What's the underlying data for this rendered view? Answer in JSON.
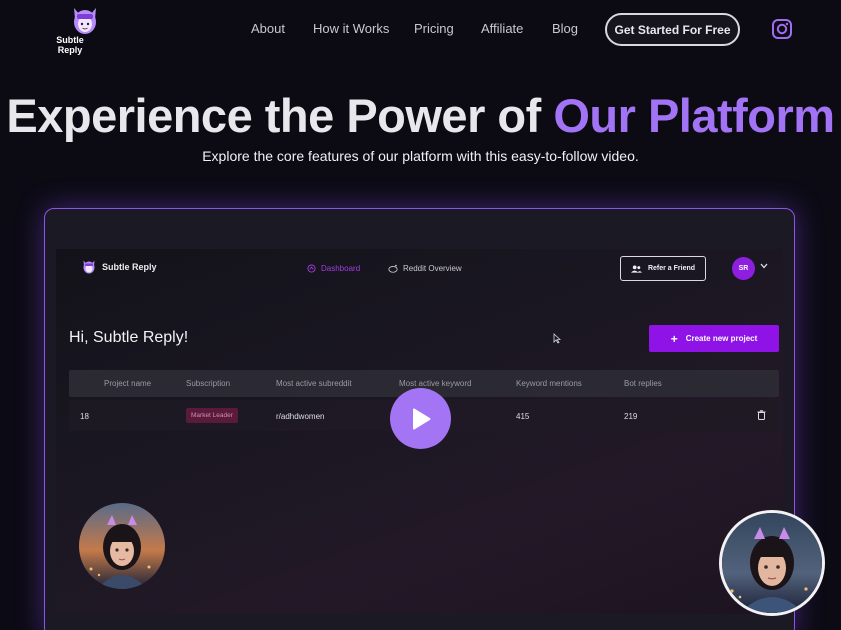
{
  "brand": {
    "line1": "Subtle",
    "line2": "Reply"
  },
  "nav": {
    "links": [
      "About",
      "How it Works",
      "Pricing",
      "Affiliate",
      "Blog"
    ],
    "cta": "Get Started For Free",
    "social_icon": "instagram-icon"
  },
  "hero": {
    "title_main": "Experience the Power of ",
    "title_accent": "Our Platform",
    "subtitle": "Explore the core features of our platform with this easy-to-follow video."
  },
  "app": {
    "logo_text": "Subtle Reply",
    "tabs": [
      "Dashboard",
      "Reddit Overview"
    ],
    "refer_label": "Refer a Friend",
    "avatar_initials": "SR",
    "greeting": "Hi, Subtle Reply!",
    "create_label": "Create new project",
    "table": {
      "headers": [
        "Project name",
        "Subscription",
        "Most active subreddit",
        "Most active keyword",
        "Keyword mentions",
        "Bot replies"
      ],
      "rows": [
        {
          "name": "18",
          "subscription": "Market Leader",
          "subreddit": "r/adhdwomen",
          "keyword": "",
          "mentions": "415",
          "replies": "219"
        }
      ]
    }
  },
  "colors": {
    "accent": "#a274f5",
    "primary_button": "#8f12e6",
    "background": "#0c0b14"
  }
}
